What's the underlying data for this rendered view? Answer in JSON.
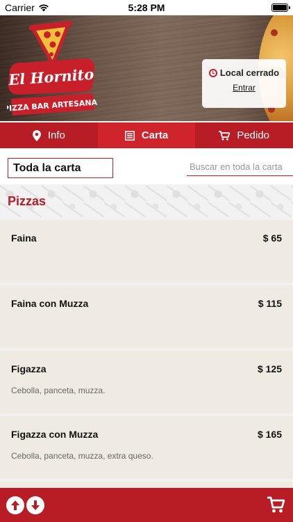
{
  "status_bar": {
    "carrier": "Carrier",
    "time": "5:28 PM"
  },
  "hero": {
    "logo_title": "El Hornito",
    "logo_subtitle": "PIZZA BAR ARTESANAL",
    "status_card": {
      "text": "Local cerrado",
      "link": "Entrar"
    }
  },
  "tabs": [
    {
      "label": "Info",
      "icon": "map-pin-icon",
      "active": false
    },
    {
      "label": "Carta",
      "icon": "menu-list-icon",
      "active": true
    },
    {
      "label": "Pedido",
      "icon": "cart-icon",
      "active": false
    }
  ],
  "filter": {
    "category": "Toda la carta",
    "search_placeholder": "Buscar en toda la carta"
  },
  "section": {
    "title": "Pizzas"
  },
  "items": [
    {
      "name": "Faina",
      "price": "$ 65",
      "description": ""
    },
    {
      "name": "Faina con Muzza",
      "price": "$ 115",
      "description": ""
    },
    {
      "name": "Figazza",
      "price": "$ 125",
      "description": "Cebolla, panceta, muzza."
    },
    {
      "name": "Figazza con Muzza",
      "price": "$ 165",
      "description": "Cebolla, panceta, muzza, extra queso."
    }
  ],
  "bottom_bar": {
    "scroll_up_icon": "arrow-up-icon",
    "scroll_down_icon": "arrow-down-icon",
    "cart_icon": "cart-icon"
  },
  "colors": {
    "brand_red": "#b81c24",
    "active_tab": "#d0242c",
    "card_bg": "#efebe3"
  }
}
